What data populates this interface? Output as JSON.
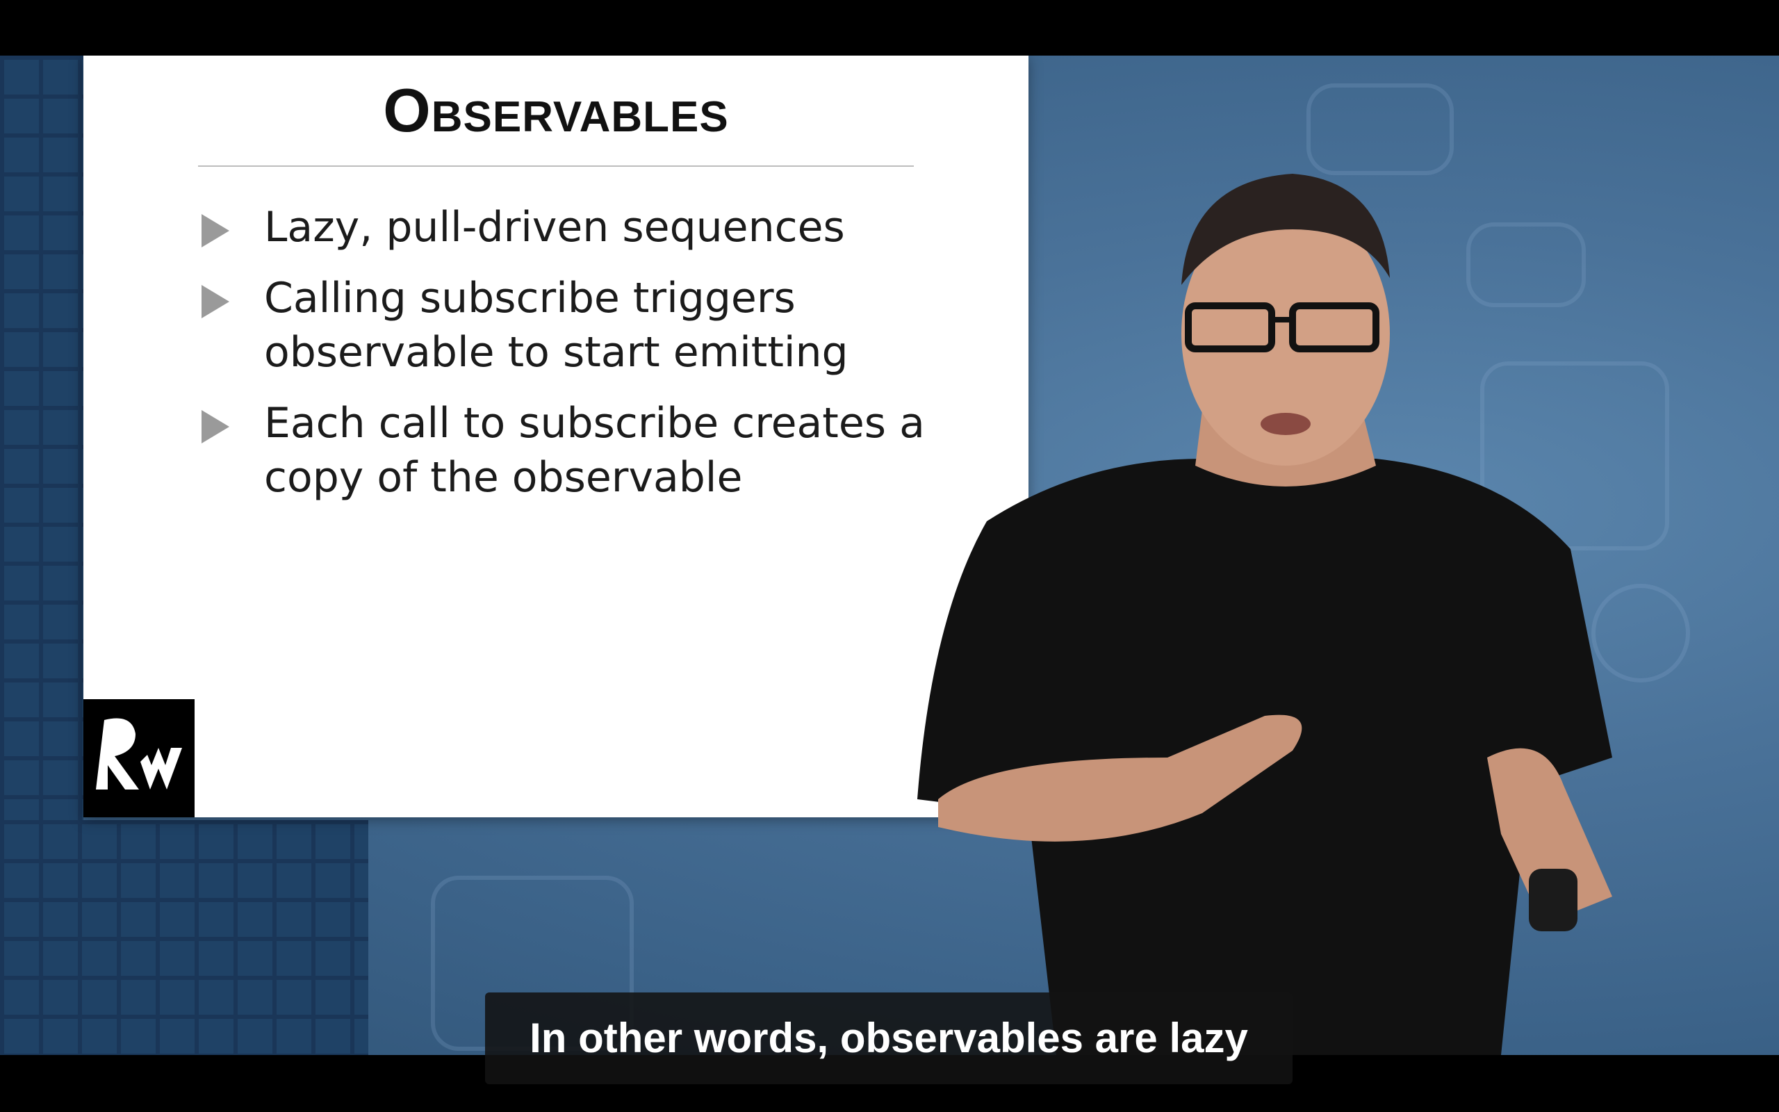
{
  "slide": {
    "title": "Observables",
    "bullets": [
      {
        "line1": "Lazy, pull-driven sequences",
        "line2": ""
      },
      {
        "line1": "Calling subscribe triggers",
        "line2": "observable to start emitting"
      },
      {
        "line1": "Each call to subscribe creates a",
        "line2": "copy of the observable"
      }
    ],
    "logo_text": "RW"
  },
  "caption": {
    "text": "In other words, observables are lazy"
  },
  "colors": {
    "background_blue": "#3b6288",
    "slide_background": "#ffffff",
    "bullet_arrow": "#9a9a9a",
    "caption_background": "#121212"
  },
  "icons": [
    "play-triangle-icon",
    "rw-logo-icon",
    "presenter-illustration"
  ]
}
